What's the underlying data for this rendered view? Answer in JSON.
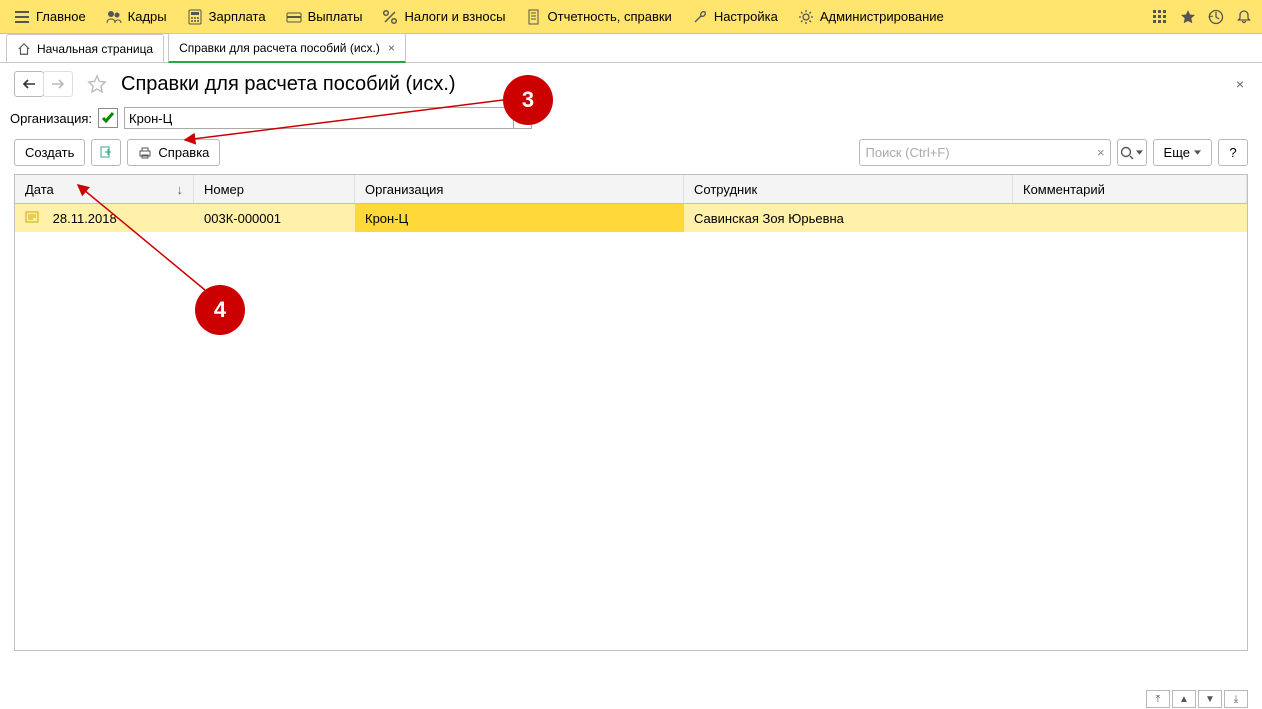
{
  "menubar": {
    "items": [
      {
        "label": "Главное"
      },
      {
        "label": "Кадры"
      },
      {
        "label": "Зарплата"
      },
      {
        "label": "Выплаты"
      },
      {
        "label": "Налоги и взносы"
      },
      {
        "label": "Отчетность, справки"
      },
      {
        "label": "Настройка"
      },
      {
        "label": "Администрирование"
      }
    ]
  },
  "tabs": {
    "home": "Начальная страница",
    "current": "Справки для расчета пособий (исх.)"
  },
  "page": {
    "title": "Справки для расчета пособий (исх.)"
  },
  "filter": {
    "label": "Организация:",
    "checked": true,
    "value": "Крон-Ц"
  },
  "commands": {
    "create": "Создать",
    "print": "Справка",
    "more": "Еще",
    "help": "?",
    "search_placeholder": "Поиск (Ctrl+F)"
  },
  "table": {
    "columns": {
      "date": "Дата",
      "number": "Номер",
      "org": "Организация",
      "employee": "Сотрудник",
      "comment": "Комментарий"
    },
    "rows": [
      {
        "date": "28.11.2018",
        "number": "003К-000001",
        "org": "Крон-Ц",
        "employee": "Савинская Зоя Юрьевна",
        "comment": ""
      }
    ]
  },
  "annotations": {
    "a3": "3",
    "a4": "4"
  }
}
